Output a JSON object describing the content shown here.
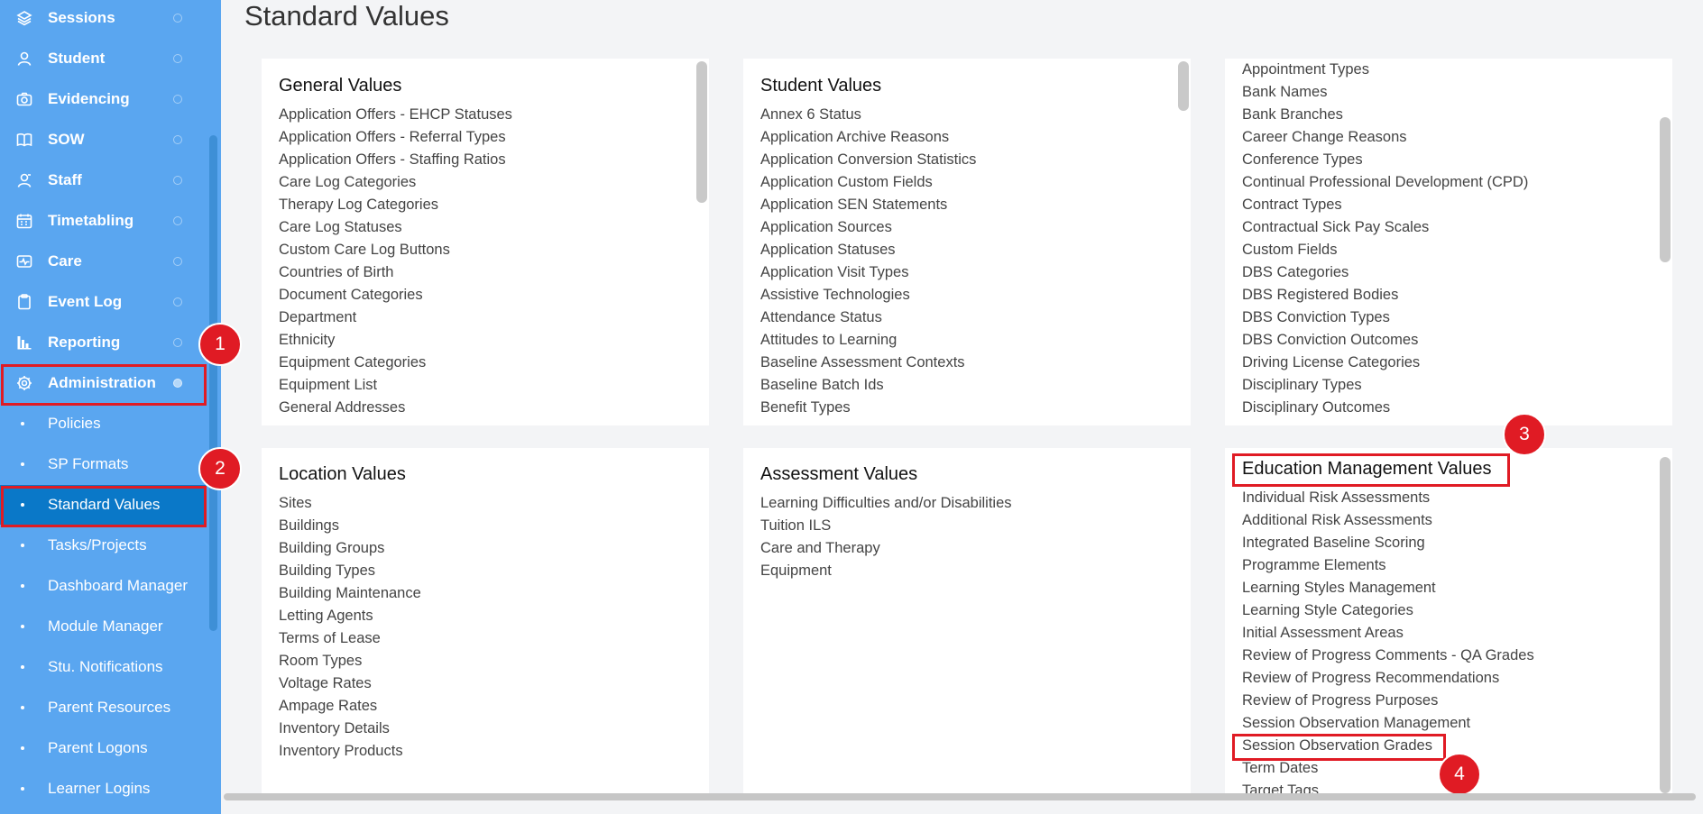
{
  "sidebar": {
    "items": [
      {
        "label": "Sessions",
        "icon": "layers-icon"
      },
      {
        "label": "Student",
        "icon": "student-icon"
      },
      {
        "label": "Evidencing",
        "icon": "camera-icon"
      },
      {
        "label": "SOW",
        "icon": "book-icon"
      },
      {
        "label": "Staff",
        "icon": "staff-icon"
      },
      {
        "label": "Timetabling",
        "icon": "calendar-icon"
      },
      {
        "label": "Care",
        "icon": "care-icon"
      },
      {
        "label": "Event Log",
        "icon": "clipboard-icon"
      },
      {
        "label": "Reporting",
        "icon": "report-icon"
      },
      {
        "label": "Administration",
        "icon": "gear-icon"
      }
    ],
    "subitems": [
      "Policies",
      "SP Formats",
      "Standard Values",
      "Tasks/Projects",
      "Dashboard Manager",
      "Module Manager",
      "Stu. Notifications",
      "Parent Resources",
      "Parent Logons",
      "Learner Logins"
    ],
    "active_subitem": "Standard Values"
  },
  "annotations": [
    "1",
    "2",
    "3",
    "4"
  ],
  "page": {
    "title": "Standard Values"
  },
  "panels": {
    "general": {
      "title": "General Values",
      "items": [
        "Application Offers - EHCP Statuses",
        "Application Offers - Referral Types",
        "Application Offers - Staffing Ratios",
        "Care Log Categories",
        "Therapy Log Categories",
        "Care Log Statuses",
        "Custom Care Log Buttons",
        "Countries of Birth",
        "Document Categories",
        "Department",
        "Ethnicity",
        "Equipment Categories",
        "Equipment List",
        "General Addresses"
      ]
    },
    "student": {
      "title": "Student Values",
      "items": [
        "Annex 6 Status",
        "Application Archive Reasons",
        "Application Conversion Statistics",
        "Application Custom Fields",
        "Application SEN Statements",
        "Application Sources",
        "Application Statuses",
        "Application Visit Types",
        "Assistive Technologies",
        "Attendance Status",
        "Attitudes to Learning",
        "Baseline Assessment Contexts",
        "Baseline Batch Ids",
        "Benefit Types"
      ]
    },
    "staff": {
      "items": [
        "Appointment Types",
        "Bank Names",
        "Bank Branches",
        "Career Change Reasons",
        "Conference Types",
        "Continual Professional Development (CPD)",
        "Contract Types",
        "Contractual Sick Pay Scales",
        "Custom Fields",
        "DBS Categories",
        "DBS Registered Bodies",
        "DBS Conviction Types",
        "DBS Conviction Outcomes",
        "Driving License Categories",
        "Disciplinary Types",
        "Disciplinary Outcomes"
      ]
    },
    "location": {
      "title": "Location Values",
      "items": [
        "Sites",
        "Buildings",
        "Building Groups",
        "Building Types",
        "Building Maintenance",
        "Letting Agents",
        "Terms of Lease",
        "Room Types",
        "Voltage Rates",
        "Ampage Rates",
        "Inventory Details",
        "Inventory Products"
      ]
    },
    "assessment": {
      "title": "Assessment Values",
      "items": [
        "Learning Difficulties and/or Disabilities",
        "Tuition ILS",
        "Care and Therapy",
        "Equipment"
      ]
    },
    "education": {
      "title": "Education Management Values",
      "items": [
        "Individual Risk Assessments",
        "Additional Risk Assessments",
        "Integrated Baseline Scoring",
        "Programme Elements",
        "Learning Styles Management",
        "Learning Style Categories",
        "Initial Assessment Areas",
        "Review of Progress Comments - QA Grades",
        "Review of Progress Recommendations",
        "Review of Progress Purposes",
        "Session Observation Management",
        "Session Observation Grades",
        "Term Dates",
        "Target Tags"
      ]
    }
  },
  "colors": {
    "sidebar": "#5aa6f0",
    "active": "#0a78c8",
    "highlight": "#e01b24"
  }
}
